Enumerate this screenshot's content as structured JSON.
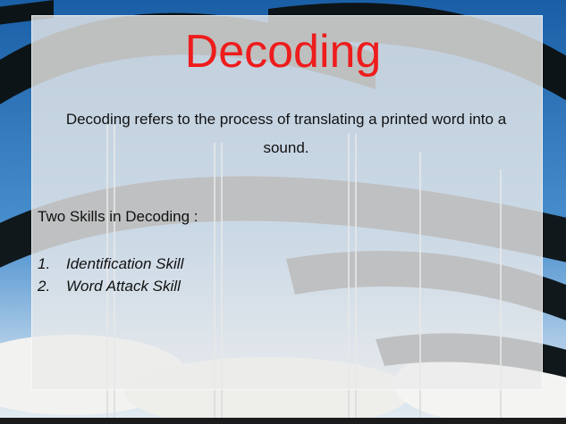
{
  "slide": {
    "title": "Decoding",
    "description": "Decoding refers to the process of translating a printed word into a sound.",
    "skills_heading": "Two Skills in Decoding :",
    "skills": [
      {
        "number": "1.",
        "label": "Identification Skill"
      },
      {
        "number": "2.",
        "label": "Word Attack Skill"
      }
    ]
  },
  "colors": {
    "title": "#ee1c1c",
    "sky": "#1f6fb4",
    "panel": "#ebebeb"
  }
}
